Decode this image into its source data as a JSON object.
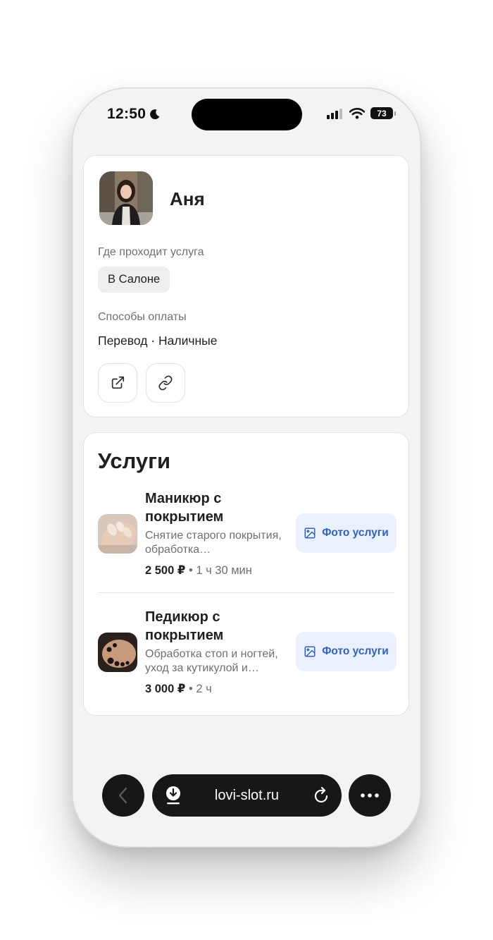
{
  "status_bar": {
    "time": "12:50",
    "battery": "73"
  },
  "profile": {
    "name": "Аня",
    "place_label": "Где проходит услуга",
    "place_value": "В Салоне",
    "payment_label": "Способы оплаты",
    "payment_value": "Перевод · Наличные",
    "buttons": [
      {
        "icon": "external-link-icon"
      },
      {
        "icon": "link-icon"
      }
    ]
  },
  "services": {
    "title": "Услуги",
    "items": [
      {
        "name": "Маникюр с покрытием",
        "description": "Снятие старого покрытия, обработка…",
        "price": "2 500 ₽",
        "duration": "1 ч 30 мин",
        "photo_button": "Фото услуги"
      },
      {
        "name": "Педикюр с покрытием",
        "description": "Обработка стоп и ногтей, уход за кутикулой и…",
        "price": "3 000 ₽",
        "duration": "2 ч",
        "photo_button": "Фото услуги"
      }
    ]
  },
  "browser": {
    "url": "lovi-slot.ru"
  },
  "colors": {
    "accent": "#2f62c8",
    "accent_bg": "#eaf1fc",
    "bar_bg": "#171717"
  }
}
